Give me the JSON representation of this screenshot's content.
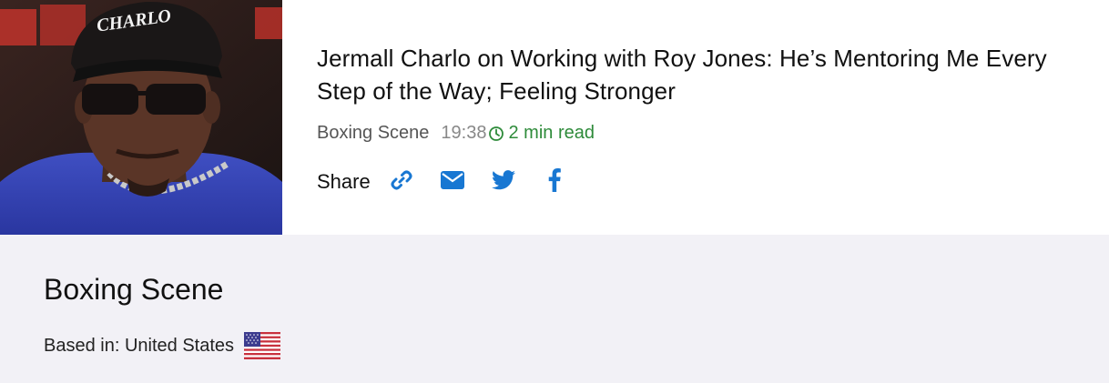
{
  "article": {
    "headline": "Jermall Charlo on Working with Roy Jones: He’s Mentoring Me Every Step of the Way; Feeling Stronger",
    "source": "Boxing Scene",
    "time": "19:38",
    "read_time": "2 min read",
    "cap_text": "CHARLO"
  },
  "share": {
    "label": "Share",
    "buttons": [
      {
        "icon": "link-icon"
      },
      {
        "icon": "email-icon"
      },
      {
        "icon": "twitter-icon"
      },
      {
        "icon": "facebook-icon"
      }
    ]
  },
  "publisher": {
    "name": "Boxing Scene",
    "based_in": "Based in: United States",
    "flag": "us-flag-icon"
  },
  "colors": {
    "accent_green": "#2e8b3a",
    "icon_blue": "#1877d2",
    "panel_bg": "#f2f1f6"
  }
}
